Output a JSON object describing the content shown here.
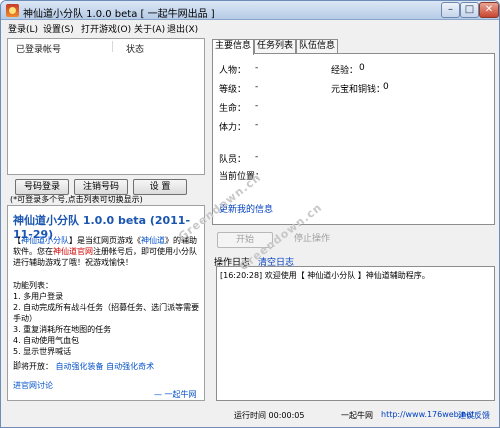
{
  "window": {
    "title": "神仙道小分队 1.0.0 beta [ 一起牛网出品 ]"
  },
  "menu": [
    "登录(L)",
    "设置(S)",
    "打开游戏(O)",
    "关于(A)",
    "退出(X)"
  ],
  "accounts": {
    "col_account": "已登录帐号",
    "col_status": "状态"
  },
  "buttons": {
    "login": "号码登录",
    "logout": "注销号码",
    "settings": "设  置"
  },
  "hint": "(*可登录多个号,点击列表可切换显示)",
  "about": {
    "title": "神仙道小分队  1.0.0 beta (2011-11-29)",
    "intro_bracket_open": "【",
    "intro_name": "神仙道小分队",
    "intro_bracket_close": "】",
    "intro_text1": "是当红网页游戏《",
    "intro_game": "神仙道",
    "intro_text2": "》的辅助软件。您在",
    "intro_site": "神仙道官网",
    "intro_text3": "注册帐号后，即可使用小分队进行辅助游戏了哦！祝游戏愉快！",
    "features_title": "功能列表：",
    "features": [
      "1. 多用户登录",
      "2. 自动完成所有战斗任务（招募任务、选门派等需要手动）",
      "3. 重复消耗所在地图的任务",
      "4. 自动使用气血包",
      "5. 显示世界喊话",
      "..."
    ],
    "coming_label": "即将开放：",
    "coming1": "自动强化装备",
    "coming2": "自动强化奇术",
    "forum_link": "进官网讨论",
    "brand": "— 一起牛网出品"
  },
  "tabs": [
    "主要信息",
    "任务列表",
    "队伍信息"
  ],
  "info": {
    "person": "人物：",
    "person_val": "-",
    "exp": "经验：",
    "exp_val": "0",
    "level": "等级：",
    "level_val": "-",
    "gold": "元宝和铜钱：",
    "gold_val": "0",
    "life": "生命：",
    "life_val": "-",
    "stamina": "体力：",
    "stamina_val": "-",
    "team": "队员：",
    "team_val": "-",
    "position": "当前位置：",
    "position_val": "",
    "detail_link": "更新我的信息"
  },
  "actions": {
    "start": "开始",
    "stop": "停止操作"
  },
  "log": {
    "label": "操作日志",
    "clear": "清空日志",
    "line": "[16:20:28] 欢迎使用【 神仙道小分队 】神仙道辅助程序。"
  },
  "footer": {
    "runtime": "运行时间 00:00:05",
    "brand": "一起牛网",
    "url": "http://www.176web.net",
    "feedback": "建议反馈"
  },
  "watermark": [
    "Greendown.cn",
    "Greendown.cn"
  ]
}
